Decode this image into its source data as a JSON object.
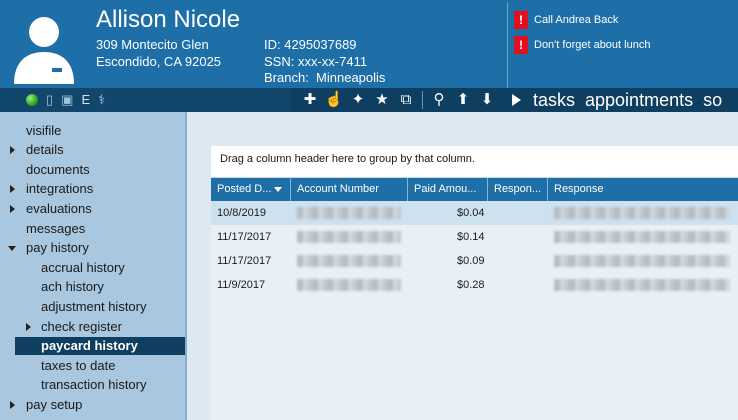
{
  "employee": {
    "name": "Allison Nicole",
    "address_line1": "309 Montecito Glen",
    "address_line2": "Escondido, CA 92025",
    "id_line": "ID: 4295037689",
    "ssn_line": "SSN: xxx-xx-7411",
    "branch_label": "Branch:",
    "branch_value": "Minneapolis"
  },
  "alerts": [
    {
      "icon": "!",
      "text": "Call Andrea Back"
    },
    {
      "icon": "!",
      "text": "Don't forget about lunch"
    }
  ],
  "toolbar": {
    "left_icons": [
      "status-online-icon",
      "phone-icon",
      "id-card-icon",
      "e-icon",
      "caduceus-icon"
    ],
    "left_glyph_e": "E",
    "actions": [
      "add-icon",
      "pointer-icon",
      "puzzle-icon",
      "star-icon",
      "external-link-icon",
      "search-icon",
      "arrow-up-icon",
      "arrow-down-icon"
    ]
  },
  "nav_tabs": {
    "tasks": "tasks",
    "appointments": "appointments",
    "more": "so"
  },
  "sidebar": {
    "items": [
      {
        "label": "visifile",
        "caret": "none",
        "level": 0
      },
      {
        "label": "details",
        "caret": "right",
        "level": 0
      },
      {
        "label": "documents",
        "caret": "none",
        "level": 0
      },
      {
        "label": "integrations",
        "caret": "right",
        "level": 0
      },
      {
        "label": "evaluations",
        "caret": "right",
        "level": 0
      },
      {
        "label": "messages",
        "caret": "none",
        "level": 0
      },
      {
        "label": "pay history",
        "caret": "down",
        "level": 0
      },
      {
        "label": "accrual history",
        "caret": "none",
        "level": 1
      },
      {
        "label": "ach history",
        "caret": "none",
        "level": 1
      },
      {
        "label": "adjustment history",
        "caret": "none",
        "level": 1
      },
      {
        "label": "check register",
        "caret": "right",
        "level": 1
      },
      {
        "label": "paycard history",
        "caret": "none",
        "level": 1,
        "selected": true
      },
      {
        "label": "taxes to date",
        "caret": "none",
        "level": 1
      },
      {
        "label": "transaction history",
        "caret": "none",
        "level": 1
      },
      {
        "label": "pay setup",
        "caret": "right",
        "level": 0
      }
    ]
  },
  "grid": {
    "group_hint": "Drag a column header here to group by that column.",
    "columns": [
      "Posted D...",
      "Account Number",
      "Paid Amou...",
      "Respon...",
      "Response"
    ],
    "rows": [
      {
        "posted": "10/8/2019",
        "amount": "$0.04"
      },
      {
        "posted": "11/17/2017",
        "amount": "$0.14"
      },
      {
        "posted": "11/17/2017",
        "amount": "$0.09"
      },
      {
        "posted": "11/9/2017",
        "amount": "$0.28"
      }
    ]
  },
  "colors": {
    "header_blue": "#1e6fa8",
    "toolbar_navy": "#0f3f60",
    "sidebar_bg": "#a9c7de",
    "alert_red": "#e0101e",
    "selected_nav": "#0f3f60"
  }
}
